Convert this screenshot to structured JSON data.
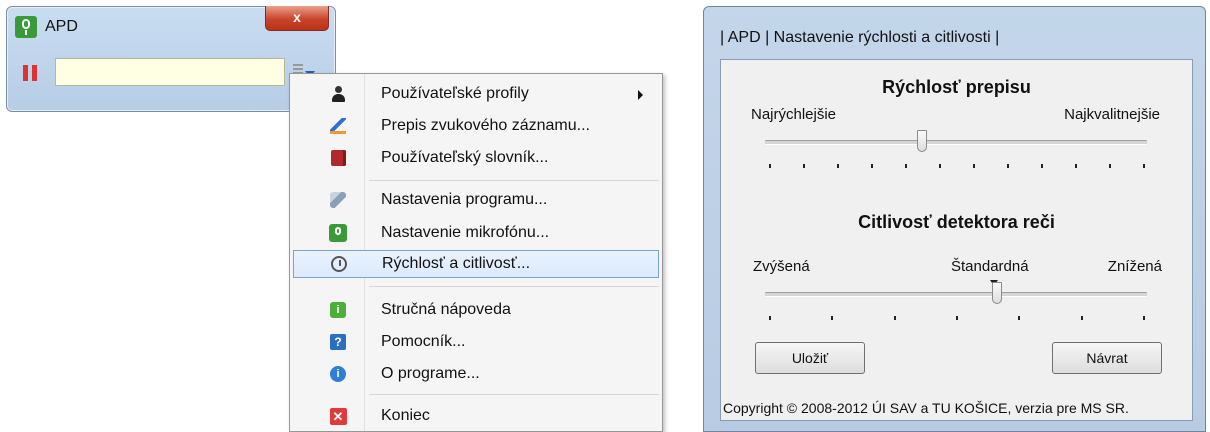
{
  "apd_window": {
    "title": "APD",
    "close_label": "x",
    "input_value": ""
  },
  "context_menu": {
    "items": [
      {
        "label": "Používateľské profily",
        "icon": "user-profile-icon"
      },
      {
        "label": "Prepis zvukového záznamu...",
        "icon": "pen-icon"
      },
      {
        "label": "Používateľský slovník...",
        "icon": "dictionary-icon"
      },
      {
        "label": "Nastavenia programu...",
        "icon": "wrench-icon"
      },
      {
        "label": "Nastavenie mikrofónu...",
        "icon": "microphone-icon"
      },
      {
        "label": "Rýchlosť a citlivosť...",
        "icon": "clock-icon"
      },
      {
        "label": "Stručná nápoveda",
        "icon": "info-icon"
      },
      {
        "label": "Pomocník...",
        "icon": "help-icon"
      },
      {
        "label": "O programe...",
        "icon": "about-icon"
      },
      {
        "label": "Koniec",
        "icon": "exit-icon"
      }
    ],
    "highlighted_item": "Rýchlosť a citlivosť..."
  },
  "settings_dialog": {
    "title": "| APD | Nastavenie rýchlosti a citlivosti |",
    "speed": {
      "heading": "Rýchlosť prepisu",
      "left_label": "Najrýchlejšie",
      "right_label": "Najkvalitnejšie",
      "tick_count": 12,
      "value_fraction": 0.41
    },
    "sensitivity": {
      "heading": "Citlivosť detektora reči",
      "left_label": "Zvýšená",
      "center_label": "Štandardná",
      "right_label": "Znížená",
      "tick_count": 7,
      "value_fraction": 0.61
    },
    "save_button": "Uložiť",
    "back_button": "Návrat",
    "copyright": "Copyright © 2008-2012 ÚI SAV a TU KOŠICE, verzia pre MS SR."
  }
}
